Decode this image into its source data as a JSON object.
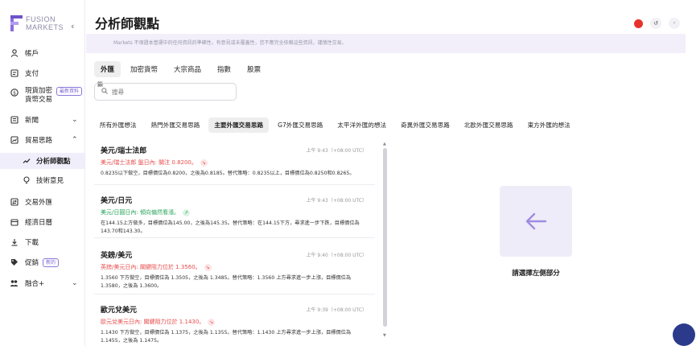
{
  "brand": {
    "line1": "FUSION",
    "line2": "MARKETS",
    "accent": "#7b5fd6"
  },
  "sidebar": {
    "items": [
      {
        "label": "帳戶",
        "icon": "user-icon"
      },
      {
        "label": "支付",
        "icon": "payment-icon"
      },
      {
        "label": "現貨加密",
        "label2": "貨幣交易",
        "badge": "最新資料",
        "icon": "crypto-icon"
      },
      {
        "label": "新聞",
        "icon": "news-icon"
      },
      {
        "label": "貿易思路",
        "icon": "trading-ideas-icon"
      },
      {
        "label": "分析師觀點",
        "icon": "trend-line-icon"
      },
      {
        "label": "技術意見",
        "icon": "bulb-icon"
      },
      {
        "label": "交易外匯",
        "icon": "forex-icon"
      },
      {
        "label": "經濟日曆",
        "icon": "calendar-icon"
      },
      {
        "label": "下載",
        "icon": "download-icon"
      },
      {
        "label": "促銷",
        "badge": "新的",
        "icon": "tag-icon"
      },
      {
        "label": "融合+",
        "icon": "group-icon"
      }
    ]
  },
  "header": {
    "title": "分析師觀點"
  },
  "notice": "Markets 不保證本營運中的任何資訊的準確性。有意見或未覆蓋性，您不應完全依賴這些資訊，謹慎性交易。",
  "categories": [
    "外匯",
    "加密貨幣",
    "大宗商品",
    "指數",
    "股票"
  ],
  "search": {
    "label": "鎖",
    "placeholder": "搜尋"
  },
  "subtabs": [
    "所有外匯想法",
    "熱門外匯交易思路",
    "主要外匯交易思路",
    "G7外匯交易思路",
    "太平洋外匯的想法",
    "奇異外匯交易思路",
    "北歐外匯交易思路",
    "東方外匯的想法"
  ],
  "cards": [
    {
      "title": "美元/瑞士法郎",
      "time": "上午 9:43（+08:00 UTC）",
      "status": "美元/瑞士法郎 盤日內: 關注 0.8200。",
      "tone": "red",
      "body": "0.8235以下做空，目標價位為0.8200，之後為0.8185。替代策略：0.8235以上，目標價位為0.8250和0.8265。"
    },
    {
      "title": "美元/日元",
      "time": "上午 9:43（+08:00 UTC）",
      "status": "美元/日圓日內: 傾向偏然看漲。",
      "tone": "green",
      "body": "在144.15上方做多，目標價位為145.00，之後為145.35。替代策略：在144.15下方，尋求進一步下跌，目標價位為143.70和143.30。"
    },
    {
      "title": "英鎊/美元",
      "time": "上午 9:40（+08:00 UTC）",
      "status": "英鎊/美元日內: 關鍵阻力位於 1.3560。",
      "tone": "red",
      "body": "1.3560 下方做空，目標價位為 1.3505，之後為 1.3485。替代策略：1.3560 上方尋求進一步上漲，目標價位為 1.3580，之後為 1.3600。"
    },
    {
      "title": "歐元兌美元",
      "time": "上午 9:39（+08:00 UTC）",
      "status": "歐元兌美元日內: 關鍵阻力位於 1.1430。",
      "tone": "red",
      "body": "1.1430 下方做空，目標價位為 1.1375，之後為 1.1355。替代策略：1.1430 上方尋求進一步上漲，目標價位為 1.1455，之後為 1.1475。"
    }
  ],
  "right_pane": {
    "prompt": "請選擇左側部分",
    "icon": "arrow-left-icon"
  }
}
